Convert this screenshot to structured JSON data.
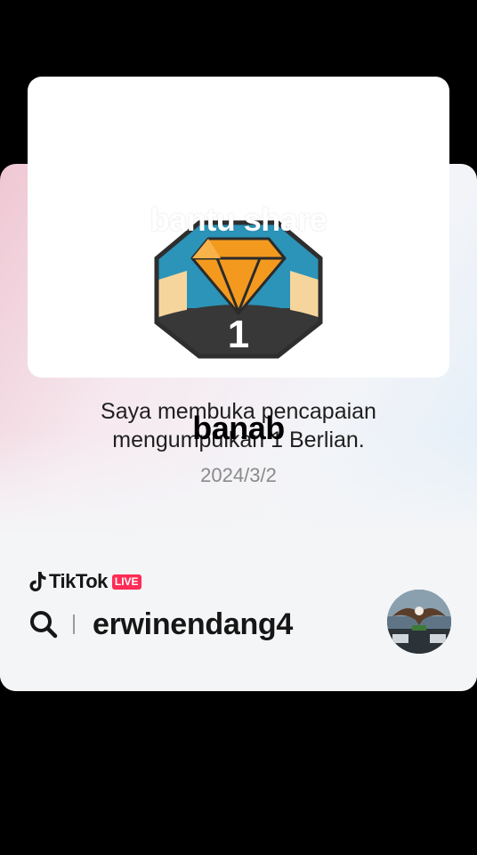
{
  "overlay": {
    "top_text": "bantu share",
    "middle_text": "banab"
  },
  "achievement": {
    "badge_number": "1",
    "line1": "Saya membuka pencapaian",
    "line2": "mengumpulkan 1 Berlian.",
    "date": "2024/3/2",
    "badge_icon": "diamond-icon"
  },
  "brand": {
    "name": "TikTok",
    "live_label": "LIVE",
    "logo_icon": "tiktok-logo-icon"
  },
  "search": {
    "icon": "search-icon",
    "username": "erwinendang4"
  },
  "colors": {
    "live_red": "#ff2c55",
    "badge_teal": "#2b94b8",
    "badge_dark": "#3a3a3a",
    "diamond_orange": "#f39a1e"
  }
}
